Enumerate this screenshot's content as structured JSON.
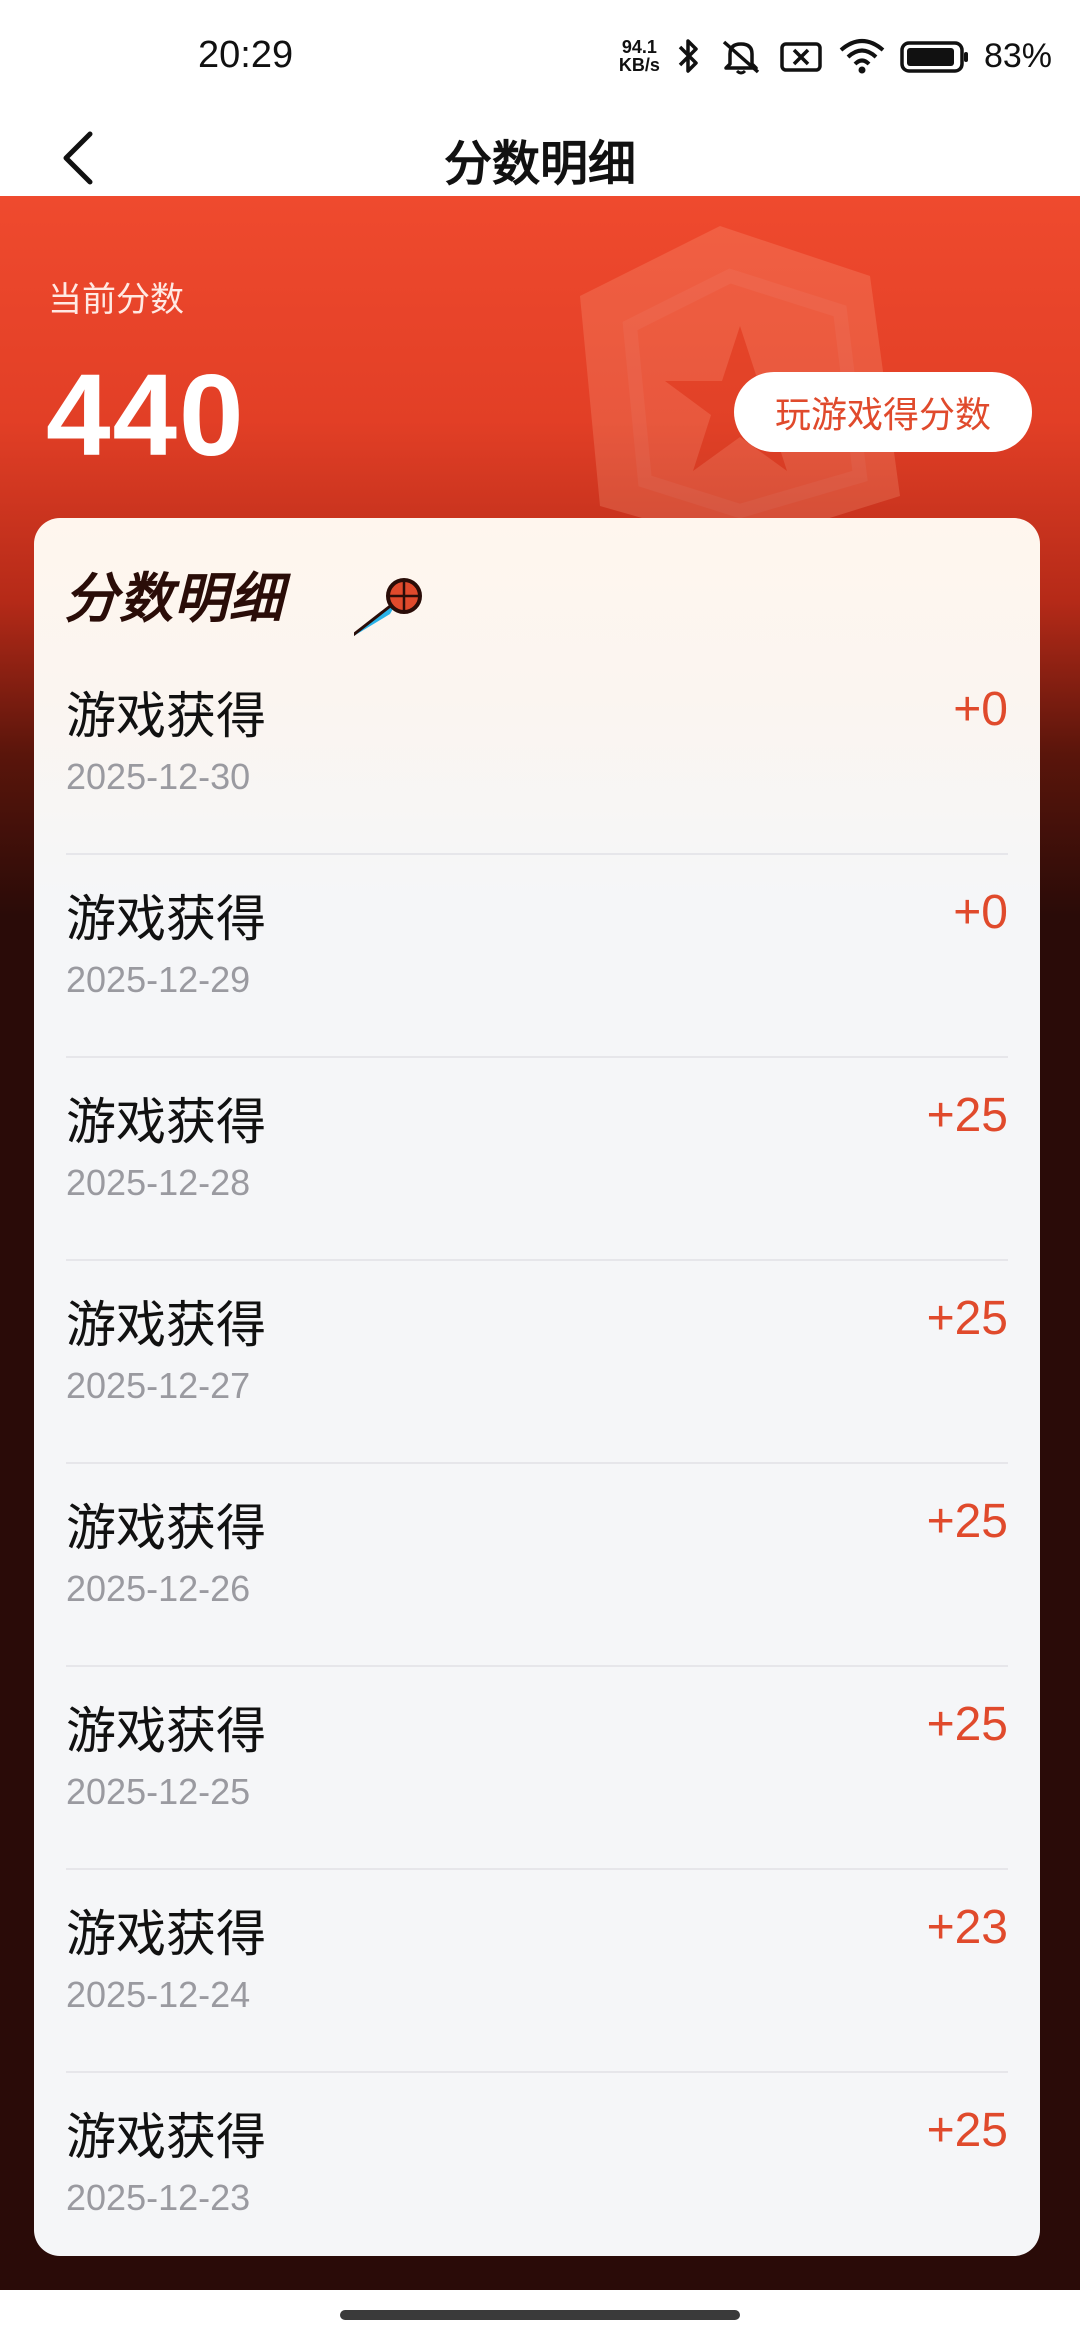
{
  "status_bar": {
    "time": "20:29",
    "net_speed_value": "94.1",
    "net_speed_unit": "KB/s",
    "battery": "83%",
    "icons": [
      "bluetooth-icon",
      "mute-icon",
      "sim-off-icon",
      "wifi-icon",
      "battery-icon"
    ]
  },
  "navbar": {
    "title": "分数明细"
  },
  "hero": {
    "score_label": "当前分数",
    "score_value": "440",
    "play_button": "玩游戏得分数"
  },
  "card": {
    "title": "分数明细",
    "items": [
      {
        "title": "游戏获得",
        "date": "2025-12-30",
        "points": "+0"
      },
      {
        "title": "游戏获得",
        "date": "2025-12-29",
        "points": "+0"
      },
      {
        "title": "游戏获得",
        "date": "2025-12-28",
        "points": "+25"
      },
      {
        "title": "游戏获得",
        "date": "2025-12-27",
        "points": "+25"
      },
      {
        "title": "游戏获得",
        "date": "2025-12-26",
        "points": "+25"
      },
      {
        "title": "游戏获得",
        "date": "2025-12-25",
        "points": "+25"
      },
      {
        "title": "游戏获得",
        "date": "2025-12-24",
        "points": "+23"
      },
      {
        "title": "游戏获得",
        "date": "2025-12-23",
        "points": "+25"
      }
    ]
  },
  "colors": {
    "accent": "#e04a2c",
    "hero_top": "#ef4a2e",
    "hero_bottom": "#2a0b08"
  }
}
